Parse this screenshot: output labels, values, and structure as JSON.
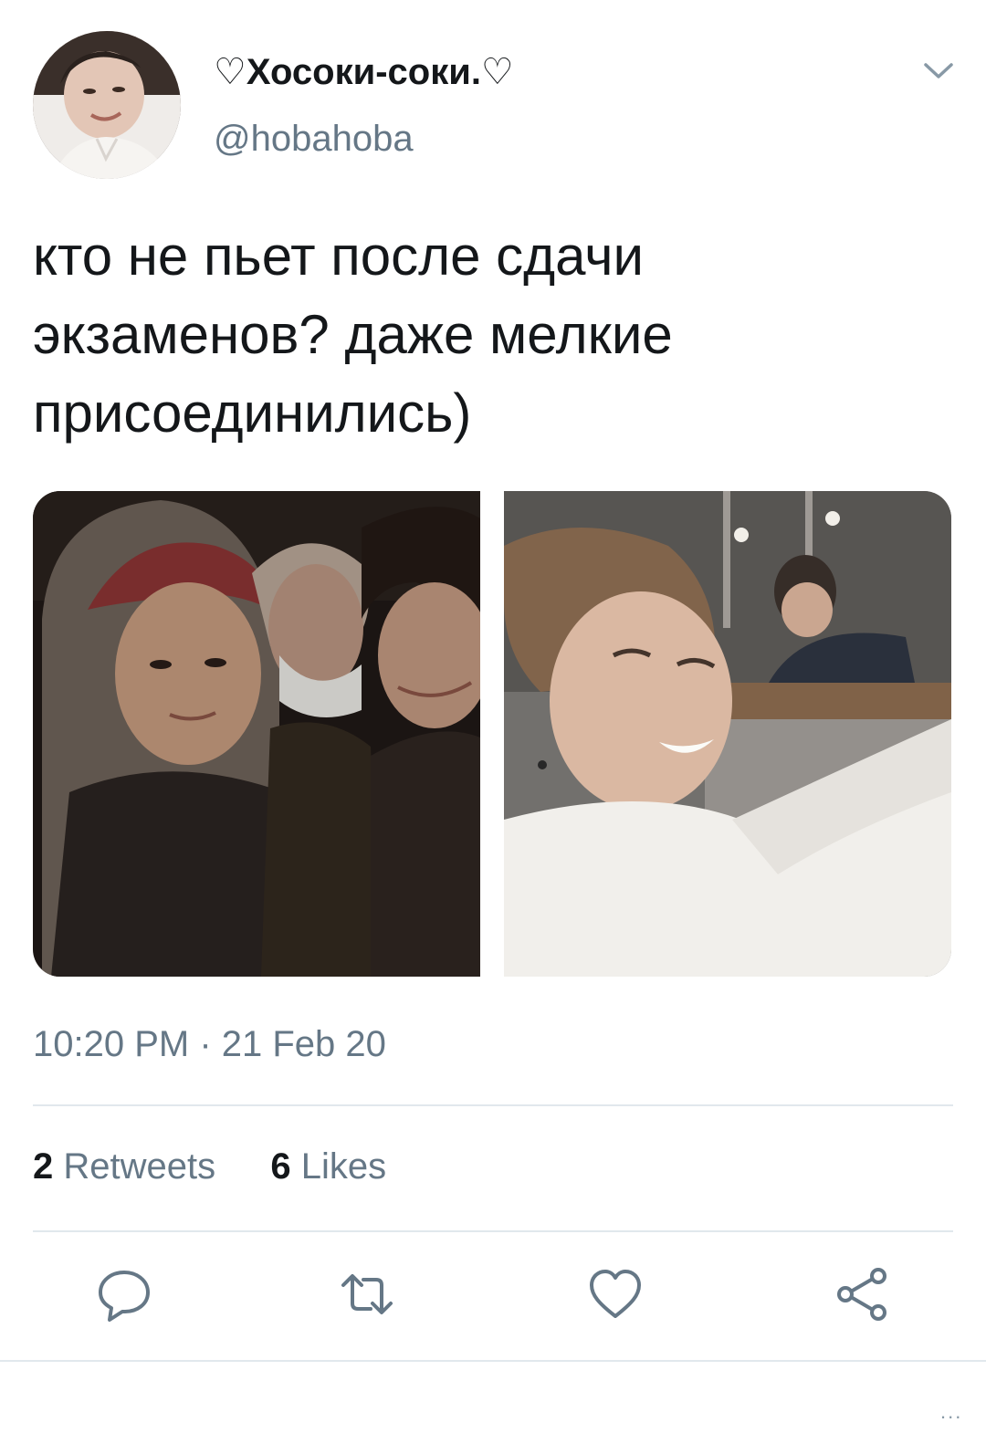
{
  "tweet": {
    "display_name": "♡Хосоки-соки.♡",
    "handle": "@hobahoba",
    "text": "кто не пьет после сдачи экзаменов? даже мелкие присоединились)",
    "timestamp": "10:20 PM · 21 Feb 20"
  },
  "stats": {
    "retweets_count": "2",
    "retweets_label": "Retweets",
    "likes_count": "6",
    "likes_label": "Likes"
  },
  "actions": [
    {
      "icon": "reply-icon"
    },
    {
      "icon": "retweet-icon"
    },
    {
      "icon": "like-icon"
    },
    {
      "icon": "share-icon"
    }
  ],
  "overflow": "..."
}
